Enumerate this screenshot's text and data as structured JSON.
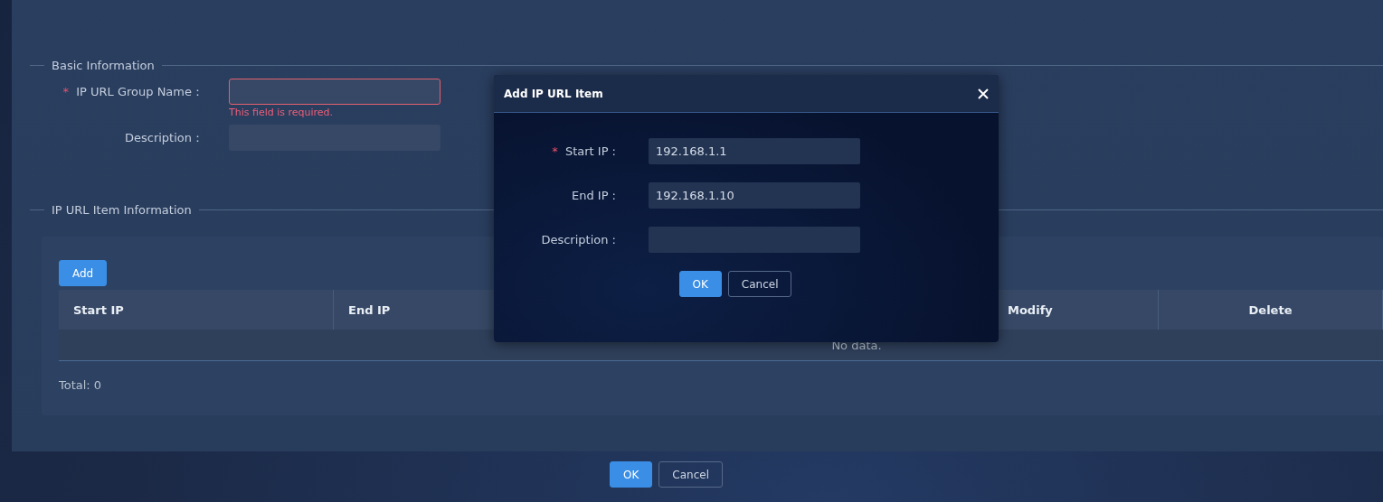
{
  "basic_information": {
    "title": "Basic Information",
    "fields": [
      {
        "label": "IP URL Group Name：",
        "required_mark": "*",
        "error": "This field is required."
      },
      {
        "label": "Description："
      }
    ]
  },
  "item_information": {
    "title": "IP URL Item Information",
    "add_button": "Add",
    "table": {
      "columns": [
        {
          "label": "Start IP"
        },
        {
          "label": "End IP"
        },
        {},
        {
          "label": "Modify"
        },
        {
          "label": "Delete"
        }
      ],
      "empty_text": "No data."
    },
    "total": "Total: 0"
  },
  "dialog": {
    "title": "Add IP URL Item",
    "fields": [
      {
        "label": "Start IP :",
        "required_mark": "*",
        "value": "192.168.1.1"
      },
      {
        "label": "End IP :",
        "value": "192.168.1.10"
      },
      {
        "label": "Description :"
      }
    ],
    "buttons": [
      {
        "label": "OK",
        "kind": "primary"
      },
      {
        "label": "Cancel",
        "kind": "default"
      }
    ]
  },
  "footer_buttons": [
    {
      "label": "OK",
      "kind": "primary"
    },
    {
      "label": "Cancel",
      "kind": "default"
    }
  ]
}
